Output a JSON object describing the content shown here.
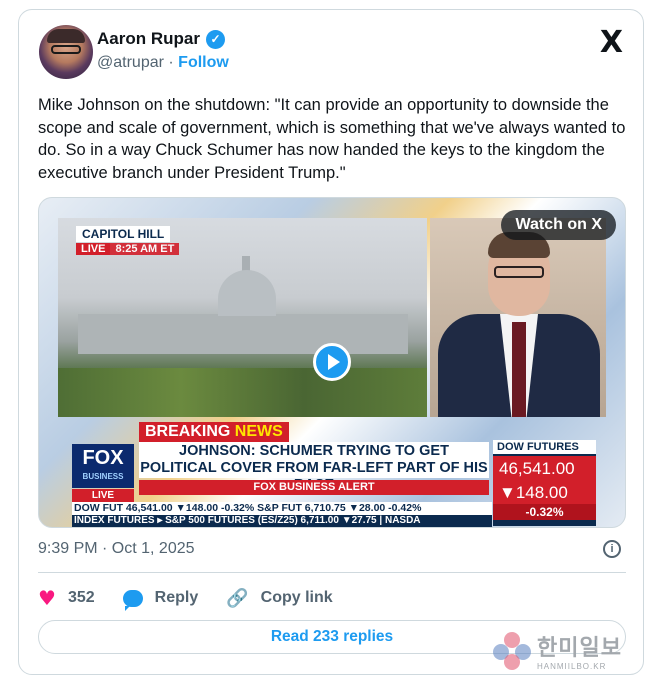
{
  "author": {
    "name": "Aaron Rupar",
    "handle": "@atrupar",
    "separator": "·",
    "follow_label": "Follow",
    "verified_icon": "verified-check-icon"
  },
  "brand": {
    "logo_label": "X"
  },
  "tweet": {
    "text": "Mike Johnson on the shutdown: \"It can provide an opportunity to downside the scope and scale of government, which is something that we've always wanted to do. So in a way Chuck Schumer has now handed the keys to the kingdom the executive branch under President Trump.\""
  },
  "media": {
    "watch_label": "Watch on X",
    "location": "CAPITOL HILL",
    "live": "LIVE",
    "time": "8:25 AM ET",
    "breaking_1": "BREAKING",
    "breaking_2": "NEWS",
    "headline": "JOHNSON: SCHUMER TRYING TO GET POLITICAL COVER FROM FAR-LEFT PART OF HIS BASE",
    "alert": "FOX BUSINESS ALERT",
    "network": "FOX",
    "network_sub": "BUSINESS",
    "network_live": "LIVE",
    "ticker_1": "DOW FUT 46,541.00 ▼148.00 -0.32% S&P FUT 6,710.75 ▼28.00 -0.42%",
    "ticker_2": "INDEX FUTURES ▸ S&P 500 FUTURES (ES/Z25) 6,711.00 ▼27.75 | NASDA",
    "dow_title": "DOW FUTURES",
    "dow_value": "46,541.00",
    "dow_change": "▼148.00",
    "dow_pct": "-0.32%"
  },
  "meta": {
    "timestamp": "9:39 PM · Oct 1, 2025"
  },
  "actions": {
    "likes": "352",
    "reply_label": "Reply",
    "copy_label": "Copy link",
    "read_replies": "Read 233 replies"
  },
  "watermark": {
    "korean": "한미일보",
    "english": "HANMIILBO.KR"
  },
  "colors": {
    "accent": "#1d9bf0",
    "like": "#f91880",
    "text": "#0f1419",
    "muted": "#536471",
    "border": "#cfd9de"
  }
}
